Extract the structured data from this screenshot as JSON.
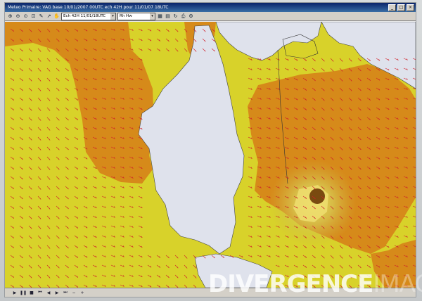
{
  "window": {
    "title": "Meteo Primaire: VAG base 10/01/2007 00UTC ech 42H pour 11/01/07 18UTC"
  },
  "toolbar": {
    "icons": [
      "zoom-in-icon",
      "zoom-out-icon",
      "zoom-fit-icon",
      "zoom-box-icon",
      "pencil-icon",
      "arrow-icon",
      "hand-icon"
    ],
    "time_select": "Ech 42H 11/01/18UTC",
    "parameter_select": "Rh Hw"
  },
  "playback": {
    "icons": [
      "play-icon",
      "pause-icon",
      "stop-icon",
      "first-icon",
      "prev-icon",
      "next-icon",
      "last-icon",
      "minus-icon",
      "plus-icon"
    ]
  },
  "watermark": {
    "main": "DIVERGENCE",
    "secondary": "IMAGES"
  },
  "colors": {
    "yellow_zone": "#d8d22a",
    "orange_zone": "#d68a1a",
    "land": "#dfe2ec",
    "wind_arrow": "#d0202a",
    "storm_core": "#7a4a10"
  }
}
